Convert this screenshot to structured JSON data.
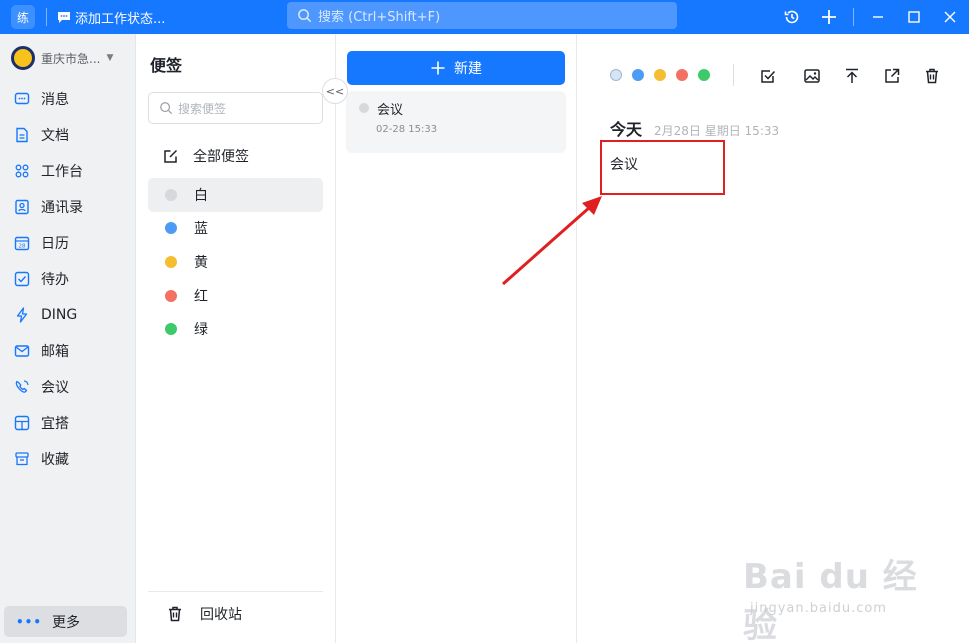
{
  "titlebar": {
    "app_badge": "练",
    "status_label": "添加工作状态...",
    "search_placeholder": "搜索 (Ctrl+Shift+F)",
    "icons": [
      "history-icon",
      "plus-icon",
      "minimize-icon",
      "maximize-icon",
      "close-icon"
    ],
    "accent": "#1677ff"
  },
  "sidebar": {
    "org_name": "重庆市急...",
    "items": [
      {
        "label": "消息",
        "icon": "message-icon"
      },
      {
        "label": "文档",
        "icon": "document-icon"
      },
      {
        "label": "工作台",
        "icon": "workbench-icon"
      },
      {
        "label": "通讯录",
        "icon": "contacts-icon"
      },
      {
        "label": "日历",
        "icon": "calendar-icon"
      },
      {
        "label": "待办",
        "icon": "todo-icon"
      },
      {
        "label": "DING",
        "icon": "ding-icon"
      },
      {
        "label": "邮箱",
        "icon": "mail-icon"
      },
      {
        "label": "会议",
        "icon": "meeting-icon"
      },
      {
        "label": "宜搭",
        "icon": "yida-icon"
      },
      {
        "label": "收藏",
        "icon": "favorites-icon"
      }
    ],
    "more_label": "更多"
  },
  "notes_panel": {
    "title": "便签",
    "search_placeholder": "搜索便签",
    "all_notes_label": "全部便签",
    "categories": [
      {
        "label": "白",
        "color": "#d6d8db"
      },
      {
        "label": "蓝",
        "color": "#4c9cf6"
      },
      {
        "label": "黄",
        "color": "#f5bd30"
      },
      {
        "label": "红",
        "color": "#f37162"
      },
      {
        "label": "绿",
        "color": "#3ec96b"
      }
    ],
    "recycle_label": "回收站"
  },
  "note_list": {
    "new_label": "新建",
    "notes": [
      {
        "title": "会议",
        "time": "02-28 15:33"
      }
    ]
  },
  "editor": {
    "today_label": "今天",
    "date_meta": "2月28日 星期日 15:33",
    "content": "会议",
    "color_options": [
      "#d6e4f5",
      "#4c9cf6",
      "#f5bd30",
      "#f37162",
      "#3ec96b"
    ],
    "tools": [
      "checkbox-icon",
      "image-icon",
      "pin-top-icon",
      "share-icon",
      "trash-icon"
    ]
  },
  "watermark": {
    "brand": "Bai du 经验",
    "url": "jingyan.baidu.com"
  }
}
